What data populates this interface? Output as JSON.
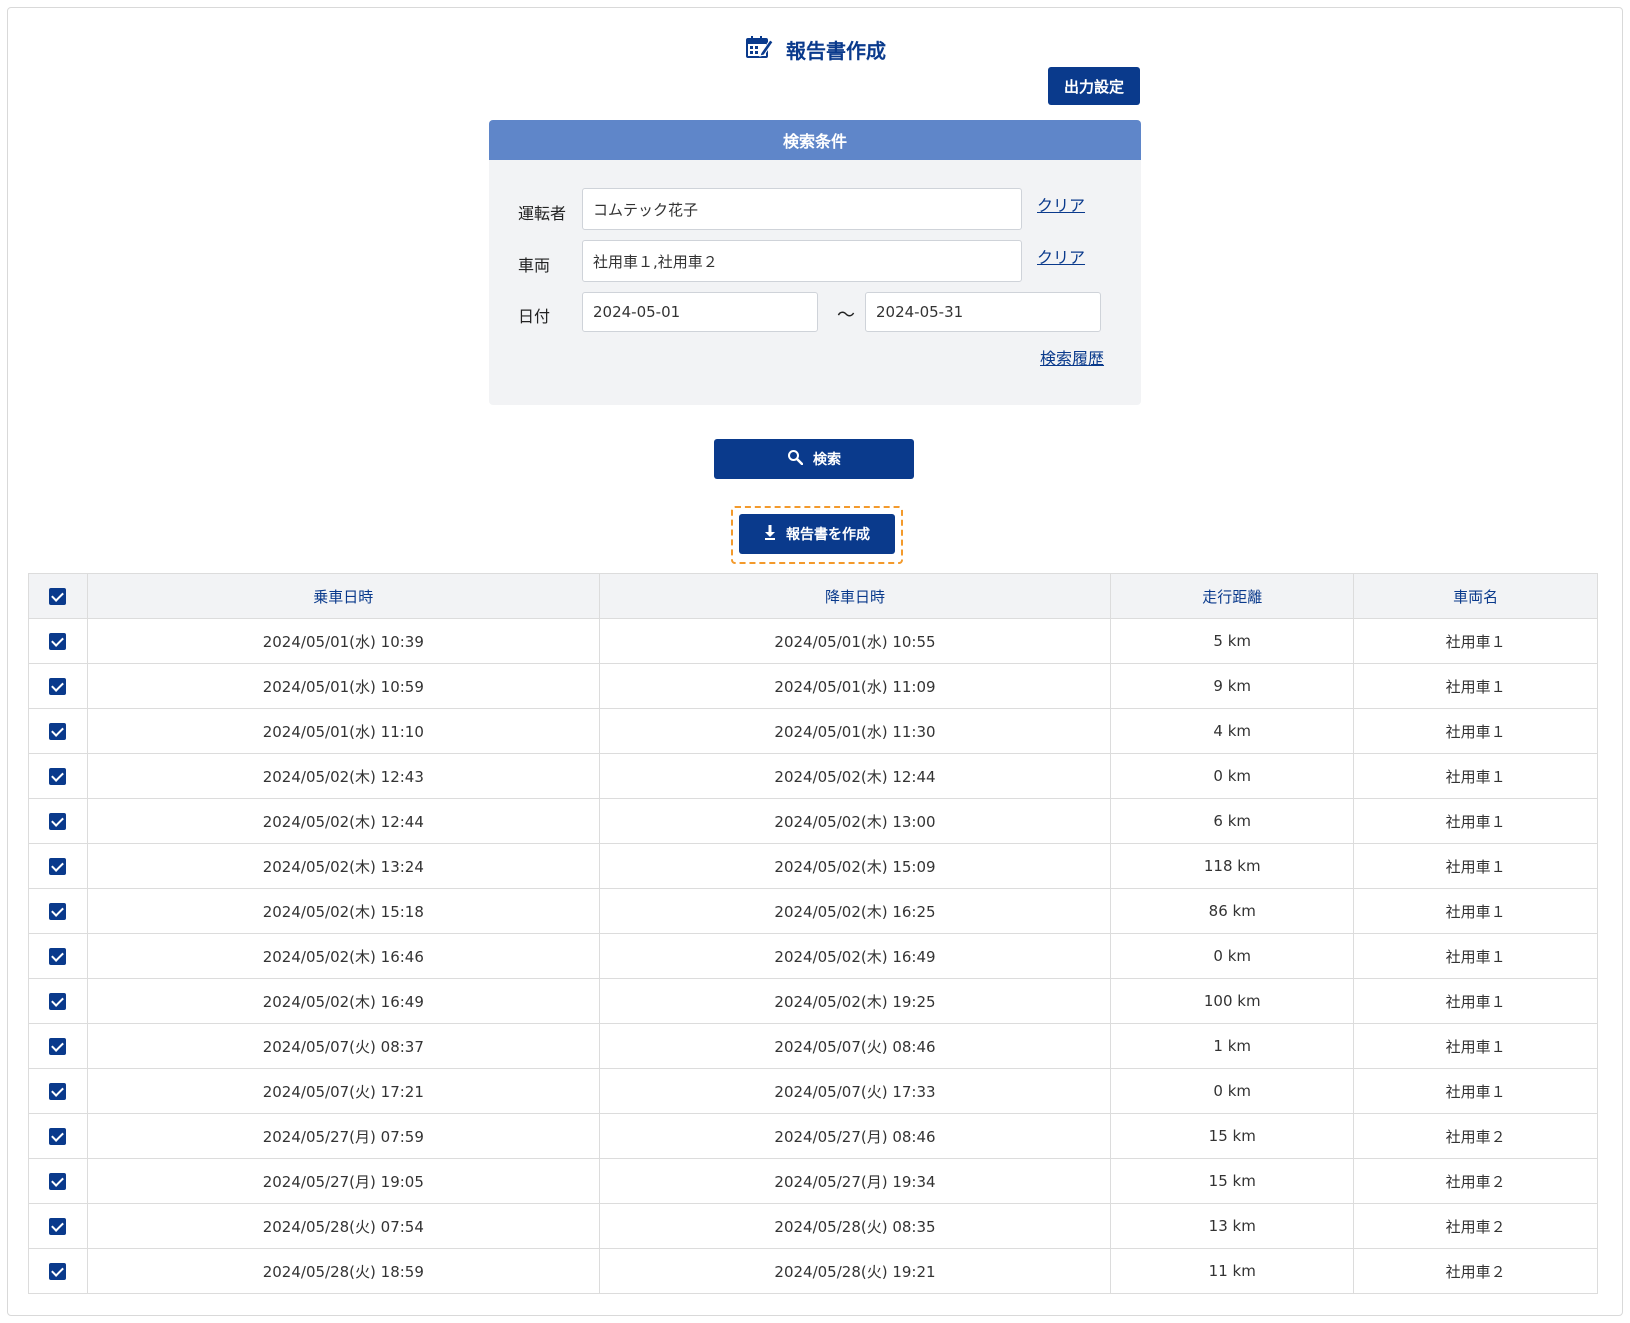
{
  "header": {
    "title": "報告書作成",
    "title_icon": "calendar-edit-icon",
    "output_button": "出力設定"
  },
  "search": {
    "heading": "検索条件",
    "driver_label": "運転者",
    "driver_value": "コムテック花子",
    "vehicle_label": "車両",
    "vehicle_value": "社用車１,社用車２",
    "date_label": "日付",
    "date_from": "2024-05-01",
    "date_sep": "～",
    "date_to": "2024-05-31",
    "clear_label": "クリア",
    "history_link": "検索履歴",
    "search_button": "検索",
    "search_icon": "search-icon"
  },
  "actions": {
    "create_report": "報告書を作成",
    "create_icon": "download-icon",
    "highlight_color": "#f39a2c"
  },
  "colors": {
    "primary": "#0a3a8c",
    "panel_header": "#5f86c9",
    "panel_bg": "#f2f3f5"
  },
  "table": {
    "header_checked": true,
    "columns": [
      "乗車日時",
      "降車日時",
      "走行距離",
      "車両名"
    ],
    "rows": [
      {
        "checked": true,
        "board": "2024/05/01(水) 10:39",
        "alight": "2024/05/01(水) 10:55",
        "distance": "5 km",
        "vehicle": "社用車１"
      },
      {
        "checked": true,
        "board": "2024/05/01(水) 10:59",
        "alight": "2024/05/01(水) 11:09",
        "distance": "9 km",
        "vehicle": "社用車１"
      },
      {
        "checked": true,
        "board": "2024/05/01(水) 11:10",
        "alight": "2024/05/01(水) 11:30",
        "distance": "4 km",
        "vehicle": "社用車１"
      },
      {
        "checked": true,
        "board": "2024/05/02(木) 12:43",
        "alight": "2024/05/02(木) 12:44",
        "distance": "0 km",
        "vehicle": "社用車１"
      },
      {
        "checked": true,
        "board": "2024/05/02(木) 12:44",
        "alight": "2024/05/02(木) 13:00",
        "distance": "6 km",
        "vehicle": "社用車１"
      },
      {
        "checked": true,
        "board": "2024/05/02(木) 13:24",
        "alight": "2024/05/02(木) 15:09",
        "distance": "118 km",
        "vehicle": "社用車１"
      },
      {
        "checked": true,
        "board": "2024/05/02(木) 15:18",
        "alight": "2024/05/02(木) 16:25",
        "distance": "86 km",
        "vehicle": "社用車１"
      },
      {
        "checked": true,
        "board": "2024/05/02(木) 16:46",
        "alight": "2024/05/02(木) 16:49",
        "distance": "0 km",
        "vehicle": "社用車１"
      },
      {
        "checked": true,
        "board": "2024/05/02(木) 16:49",
        "alight": "2024/05/02(木) 19:25",
        "distance": "100 km",
        "vehicle": "社用車１"
      },
      {
        "checked": true,
        "board": "2024/05/07(火) 08:37",
        "alight": "2024/05/07(火) 08:46",
        "distance": "1 km",
        "vehicle": "社用車１"
      },
      {
        "checked": true,
        "board": "2024/05/07(火) 17:21",
        "alight": "2024/05/07(火) 17:33",
        "distance": "0 km",
        "vehicle": "社用車１"
      },
      {
        "checked": true,
        "board": "2024/05/27(月) 07:59",
        "alight": "2024/05/27(月) 08:46",
        "distance": "15 km",
        "vehicle": "社用車２"
      },
      {
        "checked": true,
        "board": "2024/05/27(月) 19:05",
        "alight": "2024/05/27(月) 19:34",
        "distance": "15 km",
        "vehicle": "社用車２"
      },
      {
        "checked": true,
        "board": "2024/05/28(火) 07:54",
        "alight": "2024/05/28(火) 08:35",
        "distance": "13 km",
        "vehicle": "社用車２"
      },
      {
        "checked": true,
        "board": "2024/05/28(火) 18:59",
        "alight": "2024/05/28(火) 19:21",
        "distance": "11 km",
        "vehicle": "社用車２"
      }
    ]
  }
}
